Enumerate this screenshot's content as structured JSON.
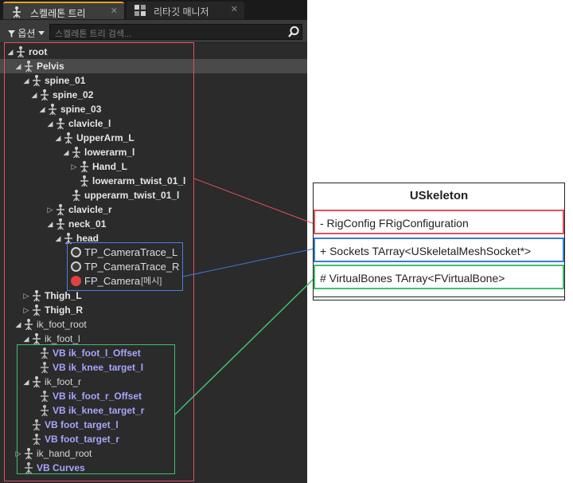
{
  "tabs": [
    {
      "label": "스켈레톤 트리",
      "icon": "skeleton-tree-icon",
      "active": true
    },
    {
      "label": "리타깃 매니저",
      "icon": "retarget-manager-icon",
      "active": false
    }
  ],
  "close_glyph": "✕",
  "toolbar": {
    "options_label": "옵션",
    "search_placeholder": "스켈레톤 트리 검색..."
  },
  "tree": [
    {
      "label": "root",
      "depth": 0,
      "expander": "open",
      "kind": "bone",
      "bold": true
    },
    {
      "label": "Pelvis",
      "depth": 1,
      "expander": "open",
      "kind": "bone",
      "bold": true,
      "selected": true
    },
    {
      "label": "spine_01",
      "depth": 2,
      "expander": "open",
      "kind": "bone",
      "bold": true
    },
    {
      "label": "spine_02",
      "depth": 3,
      "expander": "open",
      "kind": "bone",
      "bold": true
    },
    {
      "label": "spine_03",
      "depth": 4,
      "expander": "open",
      "kind": "bone",
      "bold": true
    },
    {
      "label": "clavicle_l",
      "depth": 5,
      "expander": "open",
      "kind": "bone",
      "bold": true
    },
    {
      "label": "UpperArm_L",
      "depth": 6,
      "expander": "open",
      "kind": "bone",
      "bold": true
    },
    {
      "label": "lowerarm_l",
      "depth": 7,
      "expander": "open",
      "kind": "bone",
      "bold": true
    },
    {
      "label": "Hand_L",
      "depth": 8,
      "expander": "closed",
      "kind": "bone",
      "bold": true
    },
    {
      "label": "lowerarm_twist_01_l",
      "depth": 8,
      "expander": "none",
      "kind": "bone",
      "bold": true
    },
    {
      "label": "upperarm_twist_01_l",
      "depth": 7,
      "expander": "none",
      "kind": "bone",
      "bold": true
    },
    {
      "label": "clavicle_r",
      "depth": 5,
      "expander": "closed",
      "kind": "bone",
      "bold": true
    },
    {
      "label": "neck_01",
      "depth": 5,
      "expander": "open",
      "kind": "bone",
      "bold": true
    },
    {
      "label": "head",
      "depth": 6,
      "expander": "open",
      "kind": "bone",
      "bold": true
    },
    {
      "label": "TP_CameraTrace_L",
      "depth": 7,
      "expander": "none",
      "kind": "socket",
      "socket_color": "#cfcfcf"
    },
    {
      "label": "TP_CameraTrace_R",
      "depth": 7,
      "expander": "none",
      "kind": "socket",
      "socket_color": "#cfcfcf"
    },
    {
      "label": "FP_Camera",
      "tag": "[메시]",
      "depth": 7,
      "expander": "none",
      "kind": "socket",
      "socket_color": "#e04040"
    },
    {
      "label": "Thigh_L",
      "depth": 2,
      "expander": "closed",
      "kind": "bone",
      "bold": true
    },
    {
      "label": "Thigh_R",
      "depth": 2,
      "expander": "closed",
      "kind": "bone",
      "bold": true
    },
    {
      "label": "ik_foot_root",
      "depth": 1,
      "expander": "open",
      "kind": "bone",
      "bold": false
    },
    {
      "label": "ik_foot_l",
      "depth": 2,
      "expander": "open",
      "kind": "bone",
      "bold": false
    },
    {
      "label": "VB ik_foot_l_Offset",
      "depth": 3,
      "expander": "none",
      "kind": "virtual"
    },
    {
      "label": "VB ik_knee_target_l",
      "depth": 3,
      "expander": "none",
      "kind": "virtual"
    },
    {
      "label": "ik_foot_r",
      "depth": 2,
      "expander": "open",
      "kind": "bone",
      "bold": false
    },
    {
      "label": "VB ik_foot_r_Offset",
      "depth": 3,
      "expander": "none",
      "kind": "virtual"
    },
    {
      "label": "VB ik_knee_target_r",
      "depth": 3,
      "expander": "none",
      "kind": "virtual"
    },
    {
      "label": "VB foot_target_l",
      "depth": 2,
      "expander": "none",
      "kind": "virtual"
    },
    {
      "label": "VB foot_target_r",
      "depth": 2,
      "expander": "none",
      "kind": "virtual"
    },
    {
      "label": "ik_hand_root",
      "depth": 1,
      "expander": "closed",
      "kind": "bone",
      "bold": false
    },
    {
      "label": "VB Curves",
      "depth": 1,
      "expander": "none",
      "kind": "virtual"
    }
  ],
  "uml": {
    "title": "USkeleton",
    "fields": [
      {
        "text": "- RigConfig FRigConfiguration",
        "color": "#e0505c"
      },
      {
        "text": "+ Sockets TArray<USkeletalMeshSocket*>",
        "color": "#3a7ad8"
      },
      {
        "text": "# VirtualBones TArray<FVirtualBone>",
        "color": "#3fbf70"
      }
    ]
  },
  "colors": {
    "panel_bg": "#2b2b2b",
    "tab_accent": "#e8a020",
    "virtual_bone_text": "#a8a4ff",
    "highlight_red": "#e0505c",
    "highlight_blue": "#3a7ad8",
    "highlight_green": "#3fbf70"
  }
}
